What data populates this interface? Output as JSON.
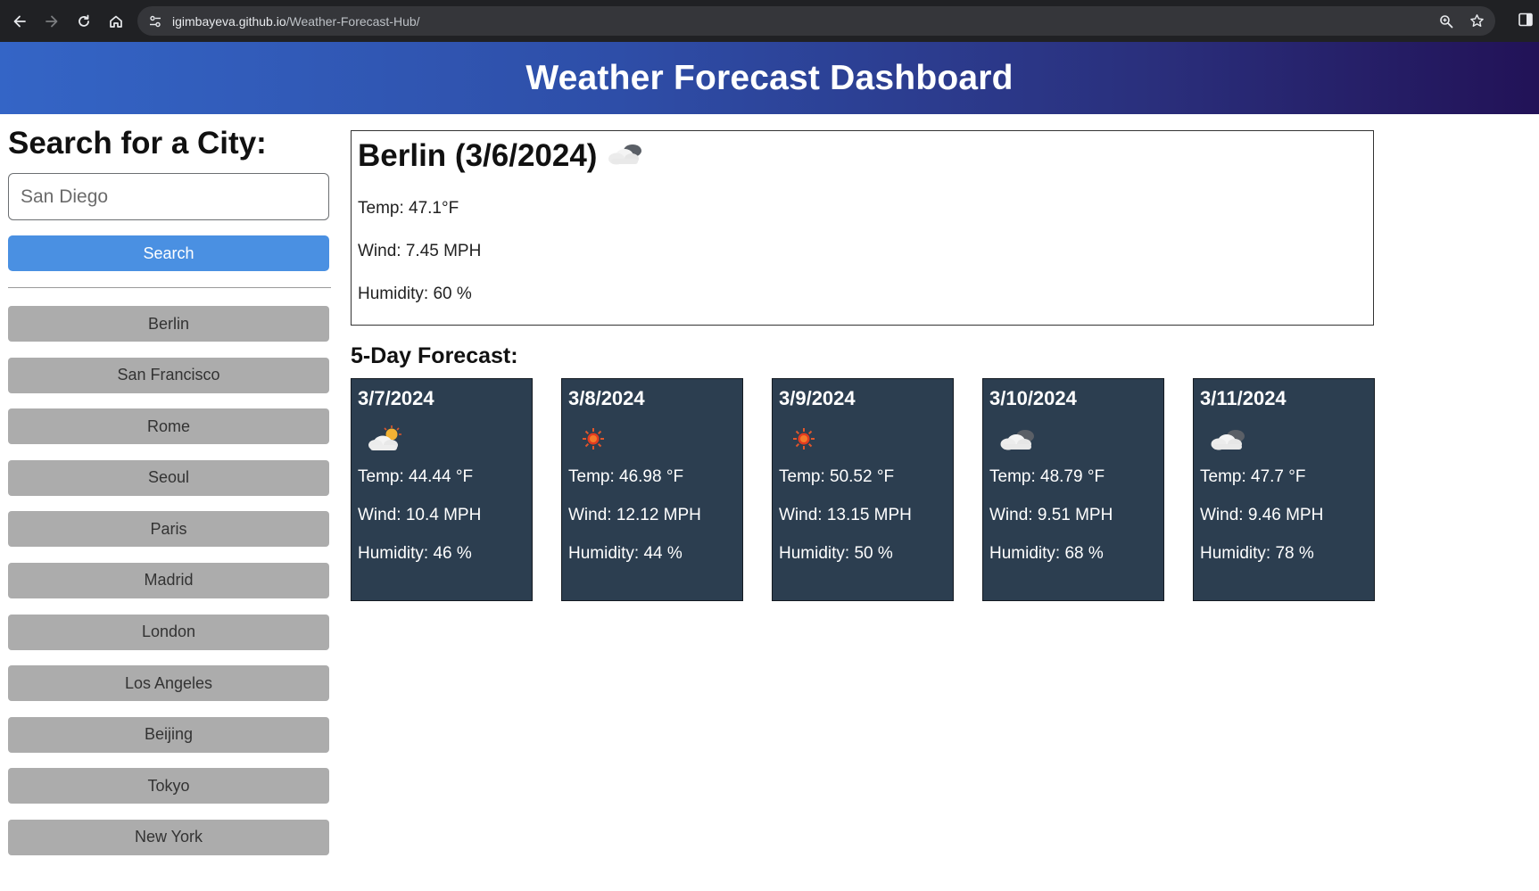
{
  "browser": {
    "url_host": "igimbayeva.github.io",
    "url_path": "/Weather-Forecast-Hub/"
  },
  "header": {
    "title": "Weather Forecast Dashboard"
  },
  "sidebar": {
    "heading": "Search for a City:",
    "search_placeholder": "San Diego",
    "search_value": "",
    "search_button": "Search",
    "history": [
      "Berlin",
      "San Francisco",
      "Rome",
      "Seoul",
      "Paris",
      "Madrid",
      "London",
      "Los Angeles",
      "Beijing",
      "Tokyo",
      "New York"
    ]
  },
  "current": {
    "title": "Berlin (3/6/2024)",
    "icon": "cloud-icon",
    "temp": "Temp: 47.1°F",
    "wind": "Wind: 7.45 MPH",
    "humidity": "Humidity: 60 %"
  },
  "forecast": {
    "heading": "5-Day Forecast:",
    "days": [
      {
        "date": "3/7/2024",
        "icon": "partly-cloudy-icon",
        "temp": "Temp: 44.44 °F",
        "wind": "Wind: 10.4 MPH",
        "humidity": "Humidity: 46 %"
      },
      {
        "date": "3/8/2024",
        "icon": "sun-icon",
        "temp": "Temp: 46.98 °F",
        "wind": "Wind: 12.12 MPH",
        "humidity": "Humidity: 44 %"
      },
      {
        "date": "3/9/2024",
        "icon": "sun-icon",
        "temp": "Temp: 50.52 °F",
        "wind": "Wind: 13.15 MPH",
        "humidity": "Humidity: 50 %"
      },
      {
        "date": "3/10/2024",
        "icon": "cloud-icon",
        "temp": "Temp: 48.79 °F",
        "wind": "Wind: 9.51 MPH",
        "humidity": "Humidity: 68 %"
      },
      {
        "date": "3/11/2024",
        "icon": "cloud-icon",
        "temp": "Temp: 47.7 °F",
        "wind": "Wind: 9.46 MPH",
        "humidity": "Humidity: 78 %"
      }
    ]
  },
  "colors": {
    "header_start": "#3465c6",
    "header_end": "#221257",
    "search_button": "#4a90e2",
    "history_button": "#acacac",
    "forecast_card": "#2c3e50"
  }
}
